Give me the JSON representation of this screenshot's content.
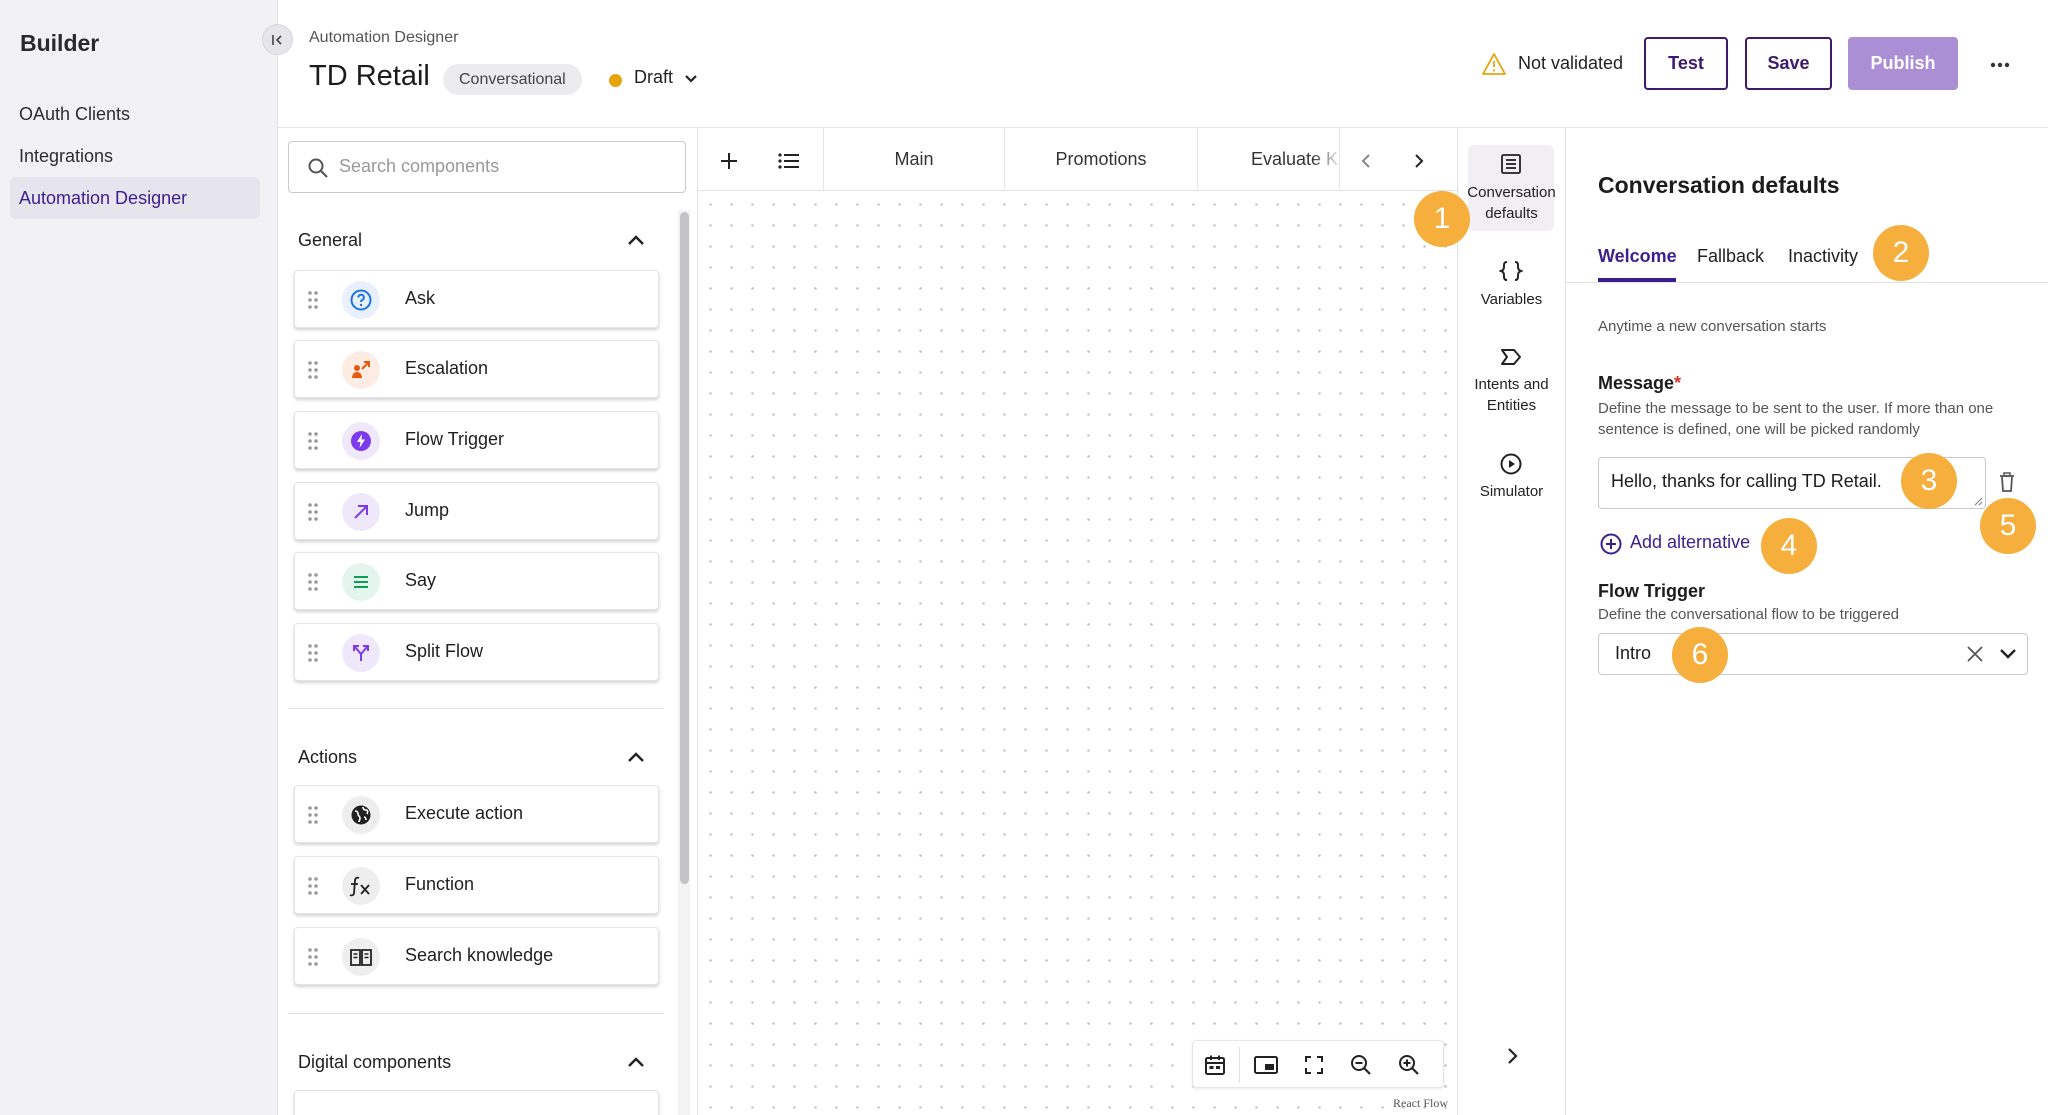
{
  "app": {
    "name": "Builder"
  },
  "nav": {
    "items": [
      {
        "label": "OAuth Clients"
      },
      {
        "label": "Integrations"
      },
      {
        "label": "Automation Designer"
      }
    ]
  },
  "header": {
    "breadcrumb": "Automation Designer",
    "title": "TD Retail",
    "type_badge": "Conversational",
    "status": "Draft",
    "status_color": "#e5a50a",
    "validation": "Not validated",
    "test_label": "Test",
    "save_label": "Save",
    "publish_label": "Publish"
  },
  "components": {
    "search_placeholder": "Search components",
    "sections": [
      {
        "title": "General",
        "items": [
          {
            "label": "Ask",
            "icon": "question-icon"
          },
          {
            "label": "Escalation",
            "icon": "escalation-icon"
          },
          {
            "label": "Flow Trigger",
            "icon": "bolt-icon"
          },
          {
            "label": "Jump",
            "icon": "arrow-up-right-icon"
          },
          {
            "label": "Say",
            "icon": "lines-icon"
          },
          {
            "label": "Split Flow",
            "icon": "split-icon"
          }
        ]
      },
      {
        "title": "Actions",
        "items": [
          {
            "label": "Execute action",
            "icon": "globe-icon"
          },
          {
            "label": "Function",
            "icon": "function-icon"
          },
          {
            "label": "Search knowledge",
            "icon": "book-icon"
          }
        ]
      },
      {
        "title": "Digital components",
        "items": []
      }
    ]
  },
  "canvas": {
    "tabs": [
      {
        "label": "Main"
      },
      {
        "label": "Promotions"
      },
      {
        "label": "Evaluate K"
      }
    ],
    "footer_label": "React Flow"
  },
  "rail": {
    "items": [
      {
        "label_line1": "Conversation",
        "label_line2": "defaults",
        "icon": "form-icon"
      },
      {
        "label_line1": "Variables",
        "label_line2": "",
        "icon": "braces-icon"
      },
      {
        "label_line1": "Intents and",
        "label_line2": "Entities",
        "icon": "intent-icon"
      },
      {
        "label_line1": "Simulator",
        "label_line2": "",
        "icon": "play-icon"
      }
    ]
  },
  "panel": {
    "title": "Conversation defaults",
    "tabs": [
      {
        "label": "Welcome",
        "active": true
      },
      {
        "label": "Fallback",
        "active": false
      },
      {
        "label": "Inactivity",
        "active": false
      }
    ],
    "description": "Anytime a new conversation starts",
    "message": {
      "label": "Message",
      "required_mark": "*",
      "description": "Define the message to be sent to the user. If more than one sentence is defined, one will be picked randomly",
      "value": "Hello, thanks for calling TD Retail."
    },
    "add_alternative_label": "Add alternative",
    "flow_trigger": {
      "label": "Flow Trigger",
      "description": "Define the conversational flow to be triggered",
      "value": "Intro"
    }
  },
  "callouts": [
    "1",
    "2",
    "3",
    "4",
    "5",
    "6"
  ],
  "colors": {
    "accent": "#3c1f8c",
    "publish": "#ab8fd4",
    "callout": "#f6ae3d",
    "required": "#d93025"
  }
}
